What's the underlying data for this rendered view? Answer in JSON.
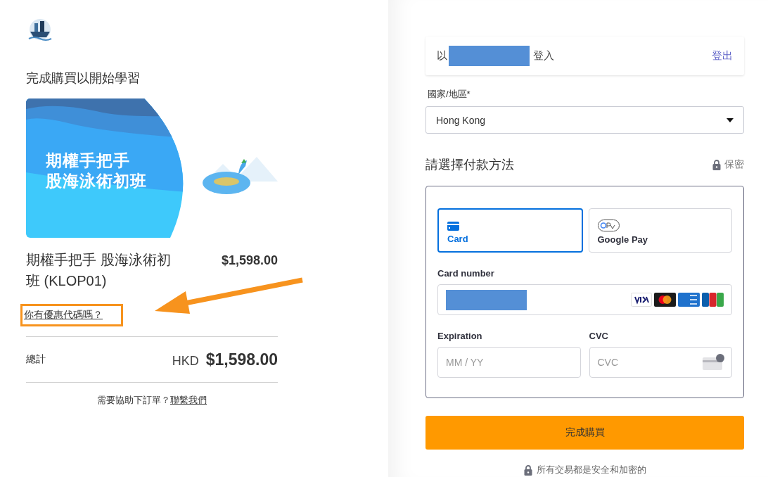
{
  "heading": "完成購買以開始學習",
  "course_banner": {
    "lines": [
      "期權手把手",
      "股海泳術初班"
    ]
  },
  "product": {
    "name": "期權手把手 股海泳術初班 (KLOP01)",
    "price": "$1,598.00"
  },
  "promo_link": "你有優惠代碼嗎？",
  "total": {
    "label": "總計",
    "currency": "HKD",
    "amount": "$1,598.00"
  },
  "help": {
    "text": "需要協助下訂單？",
    "link": "聯繫我們"
  },
  "login": {
    "prefix": "以",
    "suffix": "登入",
    "logout": "登出"
  },
  "country": {
    "label": "國家/地區*",
    "value": "Hong Kong"
  },
  "payment": {
    "title": "請選擇付款方法",
    "secure": "保密",
    "methods": [
      {
        "kind": "card",
        "label": "Card",
        "selected": true
      },
      {
        "kind": "gpay",
        "label": "Google Pay",
        "selected": false
      }
    ],
    "card_number": {
      "label": "Card number"
    },
    "expiration": {
      "label": "Expiration",
      "placeholder": "MM / YY"
    },
    "cvc": {
      "label": "CVC",
      "placeholder": "CVC"
    }
  },
  "submit": "完成購買",
  "footer_note": "所有交易都是安全和加密的"
}
